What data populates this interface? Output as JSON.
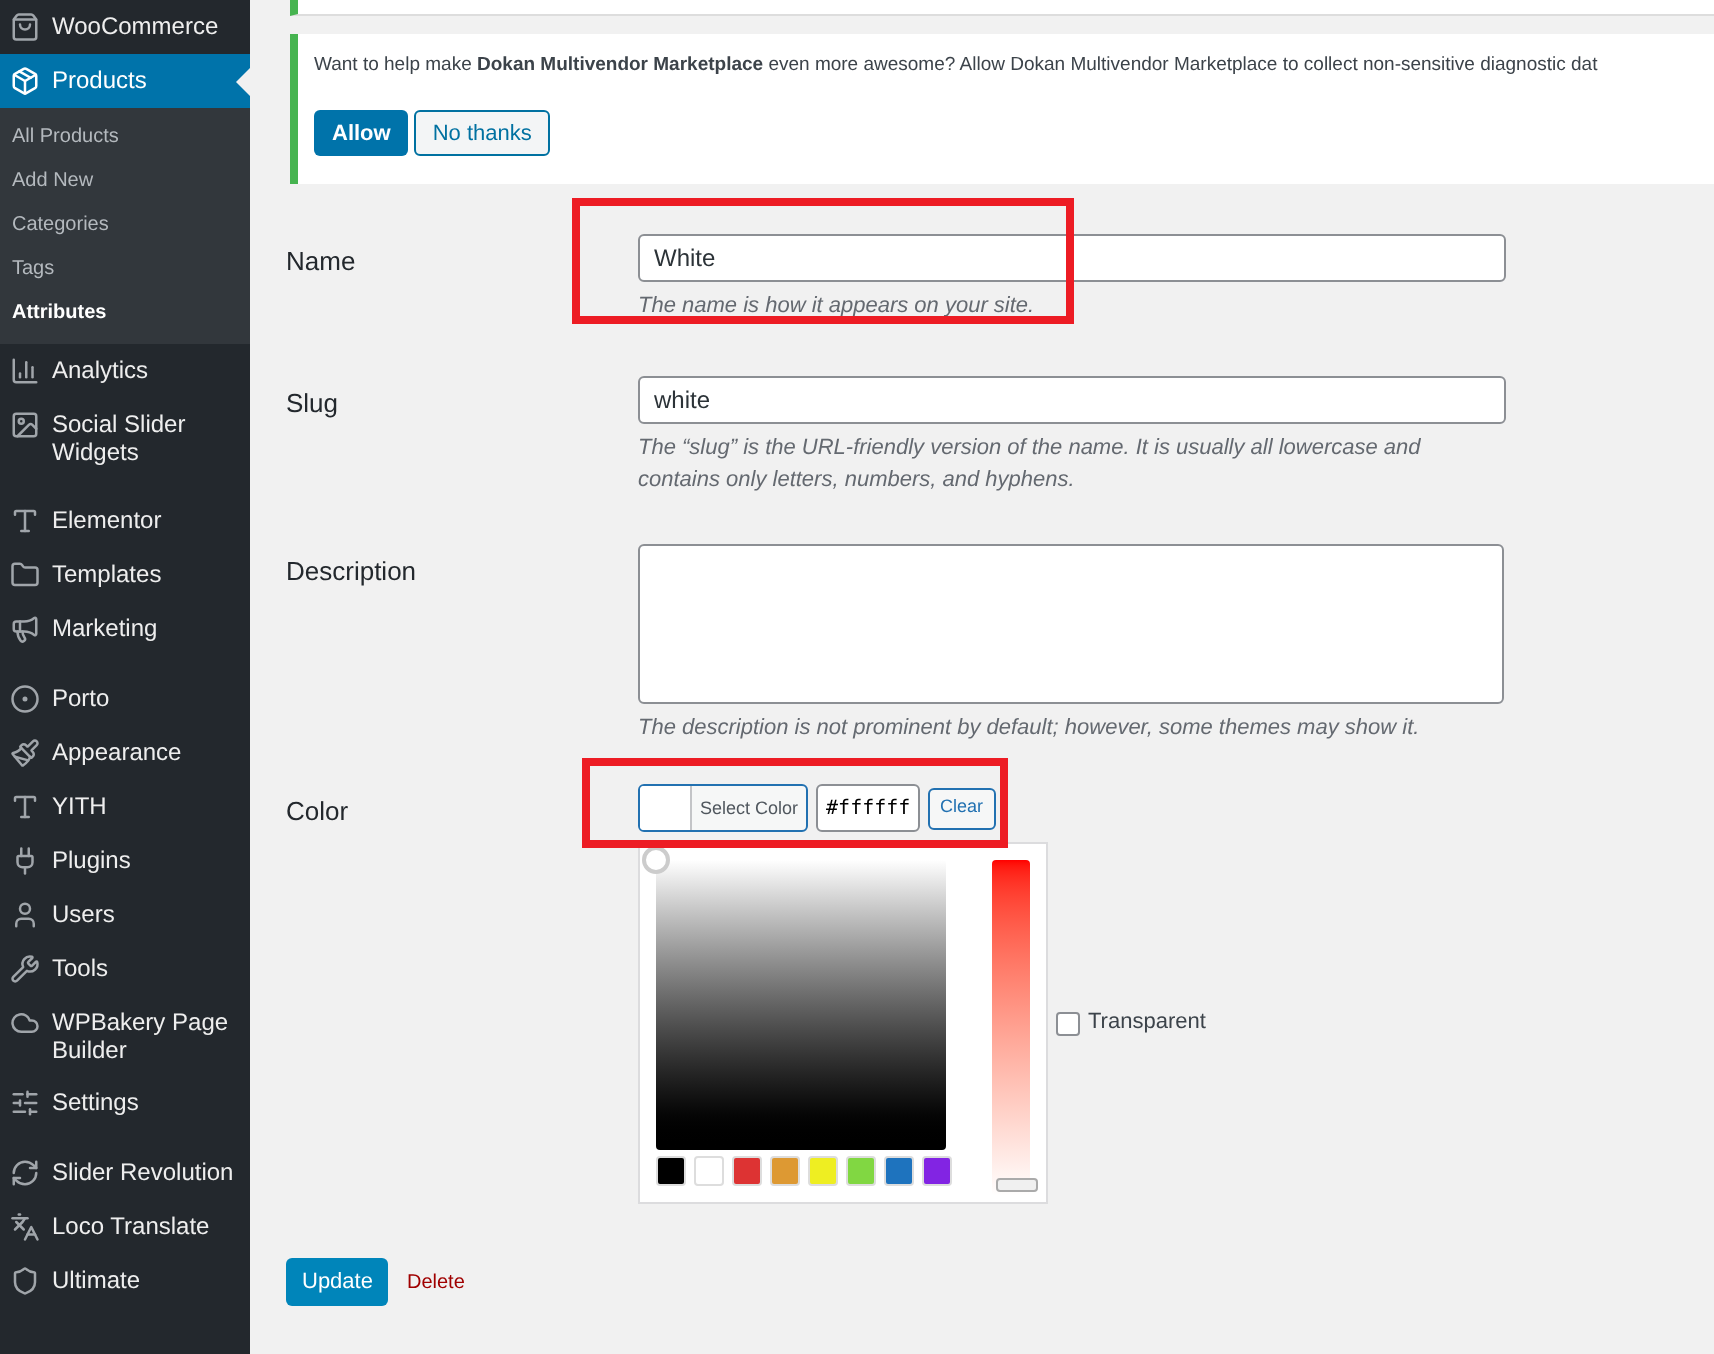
{
  "sidebar": {
    "items": [
      {
        "label": "WooCommerce",
        "selected": false
      },
      {
        "label": "Products",
        "selected": true,
        "children": [
          {
            "label": "All Products",
            "selected": false
          },
          {
            "label": "Add New",
            "selected": false
          },
          {
            "label": "Categories",
            "selected": false
          },
          {
            "label": "Tags",
            "selected": false
          },
          {
            "label": "Attributes",
            "selected": true
          }
        ]
      },
      {
        "label": "Analytics",
        "selected": false
      },
      {
        "label": "Social Slider Widgets",
        "selected": false
      },
      {
        "label": "Elementor",
        "selected": false
      },
      {
        "label": "Templates",
        "selected": false
      },
      {
        "label": "Marketing",
        "selected": false
      },
      {
        "label": "Porto",
        "selected": false
      },
      {
        "label": "Appearance",
        "selected": false
      },
      {
        "label": "YITH",
        "selected": false
      },
      {
        "label": "Plugins",
        "selected": false
      },
      {
        "label": "Users",
        "selected": false
      },
      {
        "label": "Tools",
        "selected": false
      },
      {
        "label": "WPBakery Page Builder",
        "selected": false
      },
      {
        "label": "Settings",
        "selected": false
      },
      {
        "label": "Slider Revolution",
        "selected": false
      },
      {
        "label": "Loco Translate",
        "selected": false
      },
      {
        "label": "Ultimate",
        "selected": false
      }
    ]
  },
  "notice": {
    "text": "Want to help make **Dokan Multivendor Marketplace** even more awesome? Allow Dokan Multivendor Marketplace to collect non-sensitive diagnostic dat",
    "buttons": [
      "Allow",
      "No thanks"
    ]
  },
  "form": {
    "name": {
      "label": "Name",
      "value": "White",
      "hint": "The name is how it appears on your site."
    },
    "slug": {
      "label": "Slug",
      "value": "white",
      "hint": "The “slug” is the URL-friendly version of the name. It is usually all lowercase and contains only letters, numbers, and hyphens."
    },
    "description": {
      "label": "Description",
      "hint": "The description is not prominent by default; however, some themes may show it."
    },
    "color": {
      "label": "Color",
      "button": "Select Color",
      "value": "#ffffff",
      "clear": "Clear",
      "transparent": {
        "label": "Transparent",
        "checked": false
      },
      "hue": {
        "level": 0
      },
      "swatches": [
        {
          "color": "#000000"
        },
        {
          "color": "#ffffff"
        },
        {
          "color": "#dd3333"
        },
        {
          "color": "#dd9933"
        },
        {
          "color": "#eeee22"
        },
        {
          "color": "#81d742"
        },
        {
          "color": "#1e73be"
        },
        {
          "color": "#8224e3"
        }
      ]
    }
  },
  "actions": {
    "update": "Update",
    "delete": "Delete"
  }
}
